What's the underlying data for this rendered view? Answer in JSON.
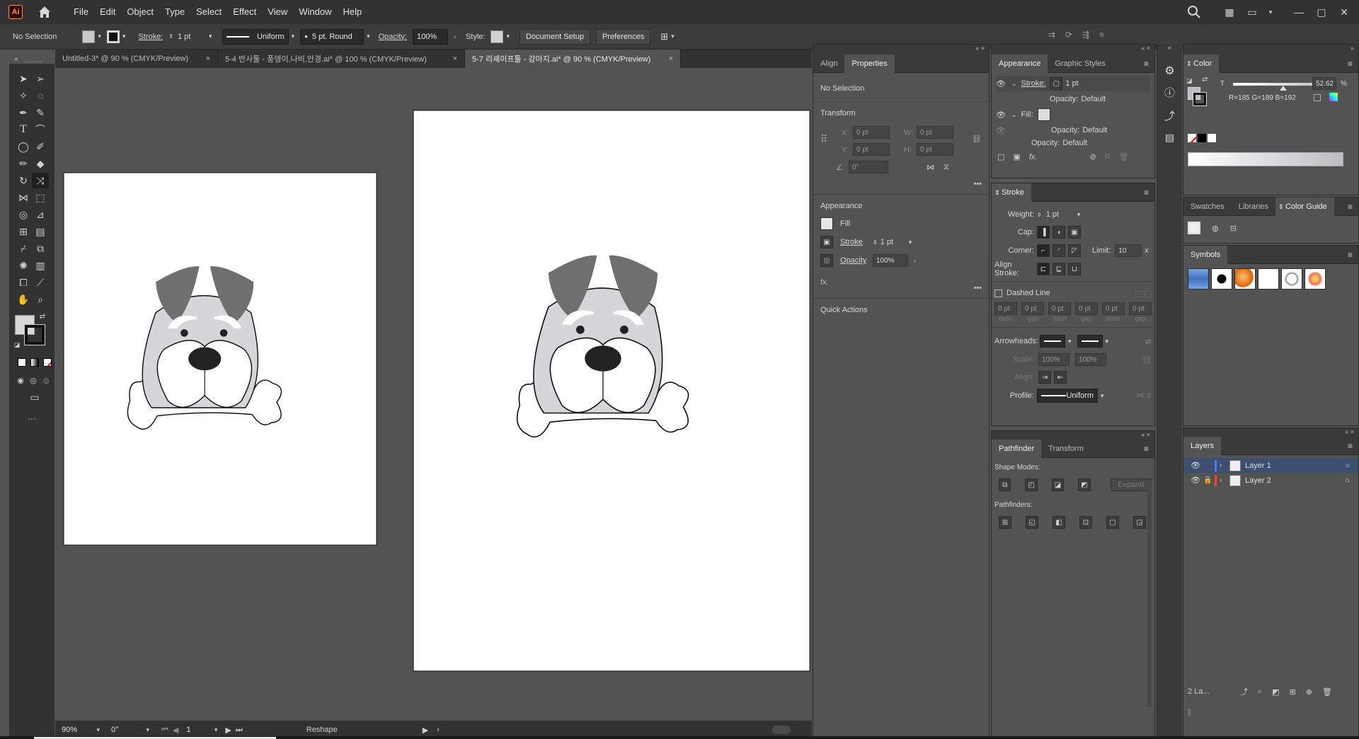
{
  "app": {
    "logo": "Ai"
  },
  "menu": [
    "File",
    "Edit",
    "Object",
    "Type",
    "Select",
    "Effect",
    "View",
    "Window",
    "Help"
  ],
  "icons": {
    "search": "search-icon",
    "arrange": "arrange-docs-icon",
    "workspace": "workspace-icon",
    "minimize": "minimize-icon",
    "maximize": "maximize-icon",
    "close": "close-icon"
  },
  "control": {
    "selection": "No Selection",
    "stroke_label": "Stroke:",
    "stroke_weight": "1 pt",
    "profile": "Uniform",
    "brush": "5 pt. Round",
    "opacity_label": "Opacity:",
    "opacity": "100%",
    "style_label": "Style:",
    "doc_setup": "Document Setup",
    "preferences": "Preferences"
  },
  "tabs": [
    {
      "title": "Untitled-3* @ 90 % (CMYK/Preview)",
      "active": false
    },
    {
      "title": "5-4 반사툴 - 풍뎅이,나비,안경.ai* @ 100 % (CMYK/Preview)",
      "active": false
    },
    {
      "title": "5-7 리셰이프툴 - 강아지.ai* @ 90 % (CMYK/Preview)",
      "active": true
    }
  ],
  "status": {
    "zoom": "90%",
    "rotation": "0°",
    "artboard": "1",
    "tool": "Reshape"
  },
  "properties": {
    "tabs": [
      "Align",
      "Properties"
    ],
    "selection": "No Selection",
    "transform_title": "Transform",
    "x_label": "X:",
    "x_value": "0 pt",
    "y_label": "Y:",
    "y_value": "0 pt",
    "w_label": "W:",
    "w_value": "0 pt",
    "h_label": "H:",
    "h_value": "0 pt",
    "angle_value": "0°",
    "appearance_title": "Appearance",
    "fill_label": "Fill",
    "stroke_label": "Stroke",
    "stroke_value": "1 pt",
    "opacity_label": "Opacity",
    "opacity_value": "100%",
    "fx": "fx.",
    "quick_actions": "Quick Actions"
  },
  "appearance": {
    "tabs": [
      "Appearance",
      "Graphic Styles"
    ],
    "stroke_label": "Stroke:",
    "stroke_value": "1 pt",
    "opacity1_label": "Opacity:",
    "opacity1_value": "Default",
    "fill_label": "Fill:",
    "opacity2_label": "Opacity:",
    "opacity2_value": "Default",
    "opacity3_label": "Opacity:",
    "opacity3_value": "Default"
  },
  "stroke": {
    "title": "Stroke",
    "weight_label": "Weight:",
    "weight_value": "1 pt",
    "cap_label": "Cap:",
    "corner_label": "Corner:",
    "limit_label": "Limit:",
    "limit_value": "10",
    "limit_unit": "x",
    "align_label": "Align Stroke:",
    "dashed_label": "Dashed Line",
    "dash_values": [
      "0 pt",
      "0 pt",
      "0 pt",
      "0 pt",
      "0 pt",
      "0 pt"
    ],
    "dash_labels": [
      "dash",
      "gap",
      "dash",
      "gap",
      "dash",
      "gap"
    ],
    "arrowheads_label": "Arrowheads:",
    "scale_label": "Scale:",
    "scale1": "100%",
    "scale2": "100%",
    "align2_label": "Align:",
    "profile_label": "Profile:",
    "profile_value": "Uniform"
  },
  "pathfinder": {
    "tabs": [
      "Pathfinder",
      "Transform"
    ],
    "shape_modes": "Shape Modes:",
    "expand": "Expand",
    "pathfinders": "Pathfinders:"
  },
  "color": {
    "title": "Color",
    "t_label": "T",
    "value": "52.62",
    "unit": "%",
    "rgb": "R=185 G=189 B=192"
  },
  "swatches": {
    "tabs": [
      "Swatches",
      "Libraries",
      "Color Guide"
    ]
  },
  "symbols": {
    "title": "Symbols"
  },
  "layers": {
    "title": "Layers",
    "items": [
      {
        "name": "Layer 1",
        "color": "#4a7bff"
      },
      {
        "name": "Layer 2",
        "color": "#ff3b3b"
      }
    ],
    "count": "2 La..."
  }
}
